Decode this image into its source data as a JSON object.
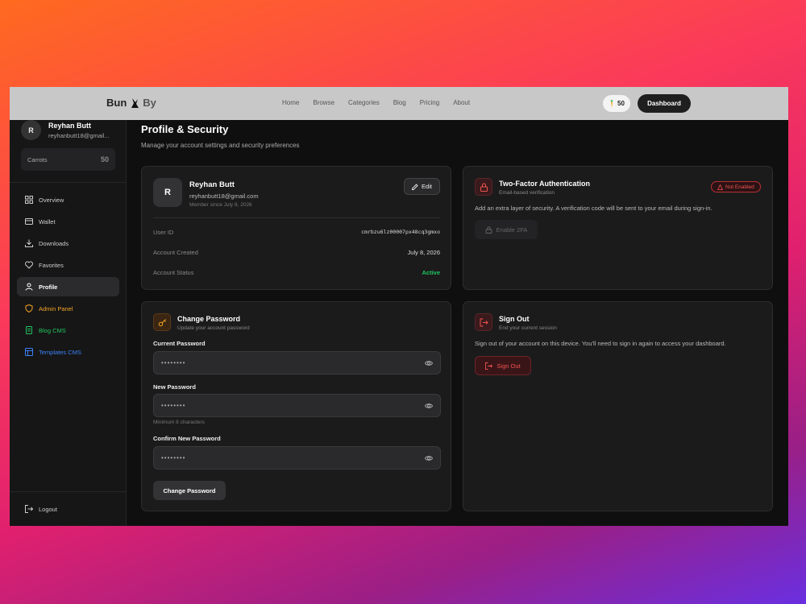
{
  "colors": {
    "accent_orange": "#f5a623",
    "accent_green": "#22c55e",
    "accent_blue": "#3b82f6",
    "danger_red": "#ef5350",
    "background": "#0f0f10"
  },
  "header": {
    "logo_main": "Bun",
    "logo_suffix": "By",
    "nav": [
      "Home",
      "Browse",
      "Categories",
      "Blog",
      "Pricing",
      "About"
    ],
    "carrots": "50",
    "dashboard_label": "Dashboard"
  },
  "sidebar": {
    "avatar_initial": "R",
    "user_name": "Reyhan Butt",
    "user_email": "reyhanbutt18@gmail...",
    "carrots_label": "Carrots",
    "carrots_value": "50",
    "items": [
      {
        "label": "Overview",
        "icon": "grid-icon"
      },
      {
        "label": "Wallet",
        "icon": "wallet-icon"
      },
      {
        "label": "Downloads",
        "icon": "download-icon"
      },
      {
        "label": "Favorites",
        "icon": "heart-icon"
      },
      {
        "label": "Profile",
        "icon": "user-icon"
      },
      {
        "label": "Admin Panel",
        "icon": "shield-icon"
      },
      {
        "label": "Blog CMS",
        "icon": "document-icon"
      },
      {
        "label": "Templates CMS",
        "icon": "layout-icon"
      }
    ],
    "logout_label": "Logout"
  },
  "main": {
    "title": "Profile & Security",
    "subtitle": "Manage your account settings and security preferences",
    "profile": {
      "avatar_initial": "R",
      "name": "Reyhan Butt",
      "email": "reyhanbutt18@gmail.com",
      "member_since": "Member since July 8, 2026",
      "edit_label": "Edit",
      "user_id_label": "User ID",
      "user_id_value": "cmrbzu6lz00007px48cq3gmxo",
      "created_label": "Account Created",
      "created_value": "July 8, 2026",
      "status_label": "Account Status",
      "status_value": "Active"
    },
    "two_factor": {
      "title": "Two-Factor Authentication",
      "subtitle": "Email-based verification",
      "badge": "Not Enabled",
      "description": "Add an extra layer of security. A verification code will be sent to your email during sign-in.",
      "button_label": "Enable 2FA"
    },
    "change_password": {
      "title": "Change Password",
      "subtitle": "Update your account password",
      "current_label": "Current Password",
      "current_value": "••••••••",
      "new_label": "New Password",
      "new_value": "••••••••",
      "new_hint": "Minimum 8 characters",
      "confirm_label": "Confirm New Password",
      "confirm_value": "••••••••",
      "button_label": "Change Password"
    },
    "sign_out": {
      "title": "Sign Out",
      "subtitle": "End your current session",
      "description": "Sign out of your account on this device. You'll need to sign in again to access your dashboard.",
      "button_label": "Sign Out"
    }
  }
}
